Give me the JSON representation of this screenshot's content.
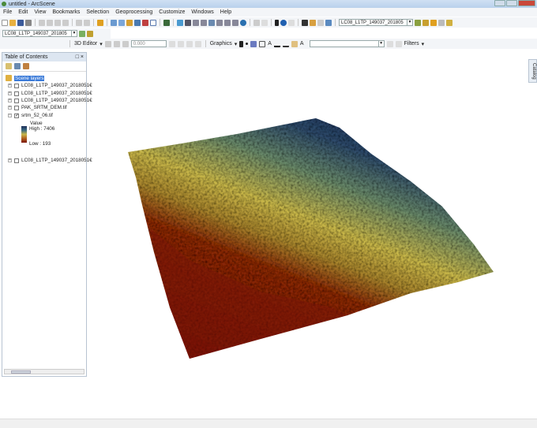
{
  "window": {
    "title": "untitled - ArcScene"
  },
  "menu": [
    "File",
    "Edit",
    "View",
    "Bookmarks",
    "Selection",
    "Geoprocessing",
    "Customize",
    "Windows",
    "Help"
  ],
  "toolbar": {
    "layer_combo": "LC08_L1TP_149037_201805",
    "layer_combo2": "LC08_L1TP_149037_201805",
    "editor_label": "3D Editor",
    "offset_value": "0.000",
    "graphics_label": "Graphics",
    "filters_label": "Filters"
  },
  "toc": {
    "title": "Table of Contents",
    "root": "Scene layers",
    "layers": [
      {
        "name": "LC08_L1TP_149037_2018051€",
        "checked": false
      },
      {
        "name": "LC08_L1TP_149037_2018051€",
        "checked": false
      },
      {
        "name": "LC08_L1TP_149037_2018051€",
        "checked": false
      },
      {
        "name": "PAK_SRTM_DEM.tif",
        "checked": false
      },
      {
        "name": "srtm_52_06.tif",
        "checked": true
      },
      {
        "name": "LC08_L1TP_149037_2018051€",
        "checked": false
      }
    ],
    "legend": {
      "title": "Value",
      "high": "High : 7406",
      "low": "Low : 193"
    }
  },
  "catalog_tab": "Catalog",
  "colors": {
    "high": "#1e2f5a",
    "mid": "#c9b84a",
    "low": "#7a1508"
  }
}
